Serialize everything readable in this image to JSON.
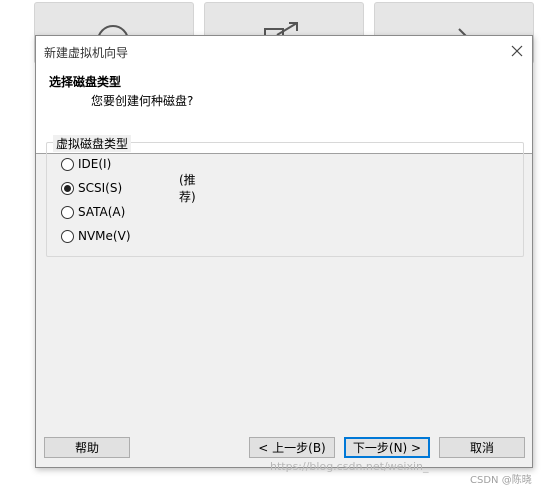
{
  "dialog": {
    "title": "新建虚拟机向导",
    "header_title": "选择磁盘类型",
    "header_subtitle": "您要创建何种磁盘?"
  },
  "disk_type_group": {
    "legend": "虚拟磁盘类型",
    "options": [
      {
        "label": "IDE(I)",
        "checked": false,
        "note": ""
      },
      {
        "label": "SCSI(S)",
        "checked": true,
        "note": "(推荐)"
      },
      {
        "label": "SATA(A)",
        "checked": false,
        "note": ""
      },
      {
        "label": "NVMe(V)",
        "checked": false,
        "note": ""
      }
    ]
  },
  "buttons": {
    "help": "帮助",
    "back": "< 上一步(B)",
    "next": "下一步(N) >",
    "cancel": "取消"
  },
  "watermark": {
    "url": "https://blog.csdn.net/weixin_",
    "author": "CSDN @陈晓"
  },
  "icons": {
    "close": "close-icon",
    "bg_tile_1": "circle-icon",
    "bg_tile_2": "open-external-icon",
    "bg_tile_3": "arrow-right-icon"
  }
}
